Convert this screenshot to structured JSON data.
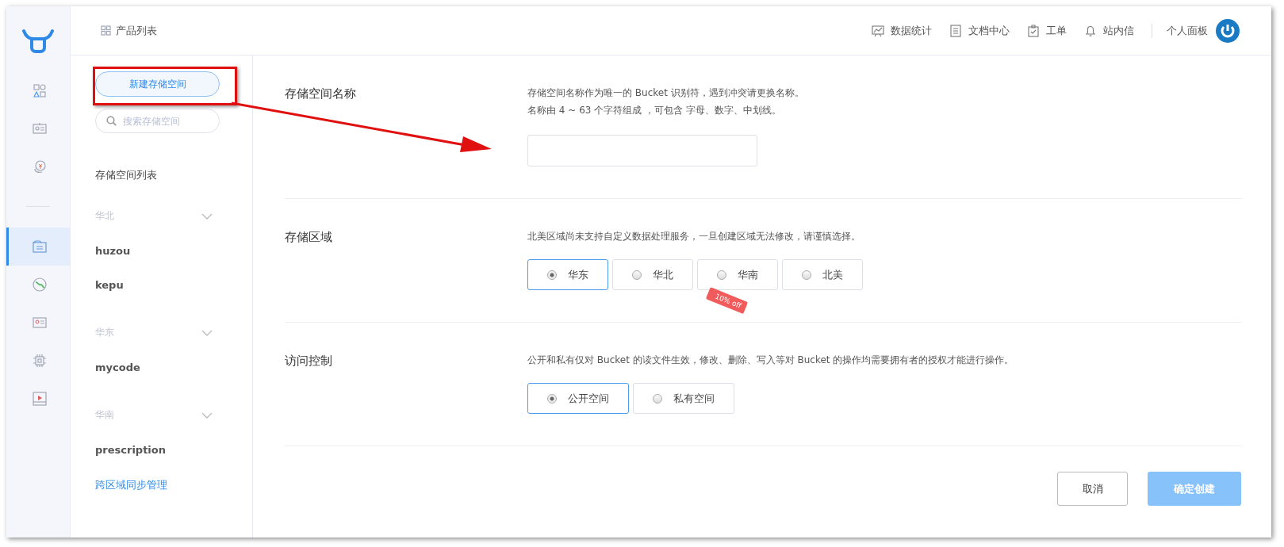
{
  "rail": {
    "items": [
      {
        "selected": false
      },
      {
        "selected": false
      },
      {
        "selected": false
      },
      {
        "selected": true
      },
      {
        "selected": false
      },
      {
        "selected": false
      },
      {
        "selected": false
      },
      {
        "selected": false
      }
    ]
  },
  "topbar": {
    "breadcrumb": "产品列表",
    "links": [
      {
        "label": "数据统计"
      },
      {
        "label": "文档中心"
      },
      {
        "label": "工单"
      },
      {
        "label": "站内信"
      }
    ],
    "user": "个人面板"
  },
  "sidebar": {
    "new_button": "新建存储空间",
    "search": {
      "placeholder": "搜索存储空间"
    },
    "list_title": "存储空间列表",
    "groups": [
      {
        "region": "华北",
        "buckets": [
          "huzou",
          "kepu"
        ]
      },
      {
        "region": "华东",
        "buckets": [
          "mycode"
        ]
      },
      {
        "region": "华南",
        "buckets": [
          "prescription"
        ]
      }
    ],
    "footer_link": "跨区域同步管理"
  },
  "form": {
    "sections": [
      {
        "kind": "input",
        "label": "存储空间名称",
        "description": [
          "存储空间名称作为唯一的 Bucket 识别符，遇到冲突请更换名称。",
          "名称由 4 ~ 63 个字符组成 ，可包含 字母、数字、中划线。"
        ]
      },
      {
        "kind": "radio",
        "label": "存储区域",
        "description": [
          "北美区域尚未支持自定义数据处理服务，一旦创建区域无法修改，请谨慎选择。"
        ],
        "options": [
          {
            "label": "华东",
            "selected": true
          },
          {
            "label": "华北",
            "selected": false
          },
          {
            "label": "华南",
            "selected": false,
            "tag": "10% off"
          },
          {
            "label": "北美",
            "selected": false
          }
        ]
      },
      {
        "kind": "radio",
        "label": "访问控制",
        "description": [
          "公开和私有仅对 Bucket 的读文件生效，修改、删除、写入等对 Bucket 的操作均需要拥有者的授权才能进行操作。"
        ],
        "options": [
          {
            "label": "公开空间",
            "selected": true
          },
          {
            "label": "私有空间",
            "selected": false
          }
        ]
      }
    ],
    "cancel": "取消",
    "confirm": {
      "label": "确定创建",
      "disabled": true
    }
  }
}
